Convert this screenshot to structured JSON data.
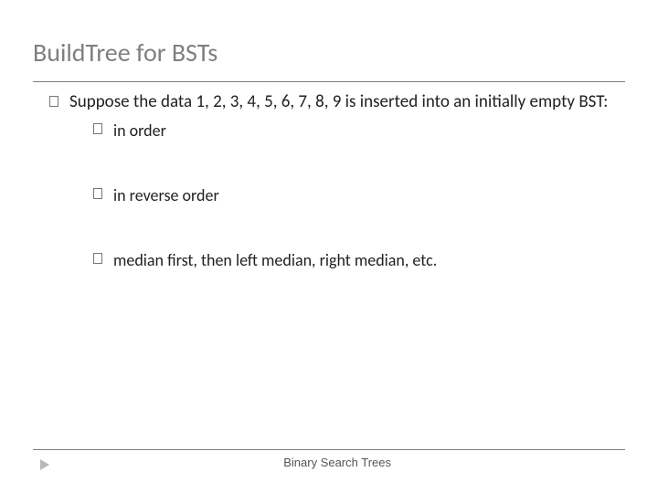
{
  "title": "BuildTree for BSTs",
  "main_bullet": "Suppose the data 1, 2, 3, 4, 5, 6, 7, 8, 9 is inserted into an initially empty BST:",
  "sub_bullets": [
    "in order",
    "in reverse order",
    "median first, then left median, right median, etc."
  ],
  "footer_label": "Binary Search Trees"
}
